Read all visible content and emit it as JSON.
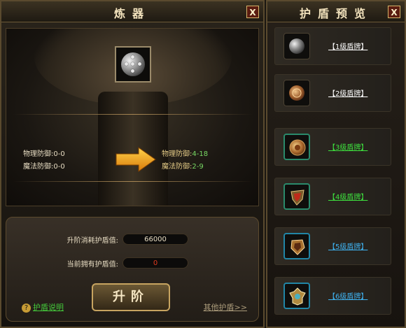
{
  "forge": {
    "title": "炼器",
    "close": "X",
    "current_stats": [
      {
        "label": "物理防御:",
        "value": "0-0"
      },
      {
        "label": "魔法防御:",
        "value": "0-0"
      }
    ],
    "upgraded_stats": [
      {
        "label": "物理防御:",
        "value": "4-18"
      },
      {
        "label": "魔法防御:",
        "value": "2-9"
      }
    ],
    "cost_label": "升阶消耗护盾值:",
    "cost_value": "66000",
    "owned_label": "当前拥有护盾值:",
    "owned_value": "0",
    "upgrade_button": "升阶",
    "help_link": "护盾说明",
    "other_link": "其他护盾>>"
  },
  "preview": {
    "title": "护盾预览",
    "close": "X",
    "items": [
      {
        "name": "【1级盾牌】",
        "color": "#ffffff"
      },
      {
        "name": "【2级盾牌】",
        "color": "#ffffff"
      },
      {
        "name": "【3级盾牌】",
        "color": "#3ee23e"
      },
      {
        "name": "【4级盾牌】",
        "color": "#3ee23e"
      },
      {
        "name": "【5级盾牌】",
        "color": "#3fb2f0"
      },
      {
        "name": "【6级盾牌】",
        "color": "#3fb2f0"
      }
    ]
  },
  "colors": {
    "gold": "#d6b46a",
    "arrow": "#f0a61a",
    "owned_value": "#e03b1f"
  }
}
